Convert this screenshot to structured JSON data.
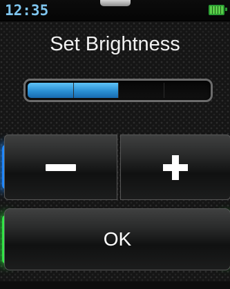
{
  "status_bar": {
    "time": "12:35",
    "battery_icon": "battery-full-icon",
    "battery_color": "#2b9d34"
  },
  "title": "Set Brightness",
  "brightness": {
    "level": 0.5,
    "segments": 4,
    "fill_color": "#2a8fd3"
  },
  "buttons": {
    "decrease_icon": "minus-icon",
    "increase_icon": "plus-icon",
    "ok_label": "OK",
    "accent_blue": "#1a7cff",
    "accent_green": "#2adf40"
  }
}
